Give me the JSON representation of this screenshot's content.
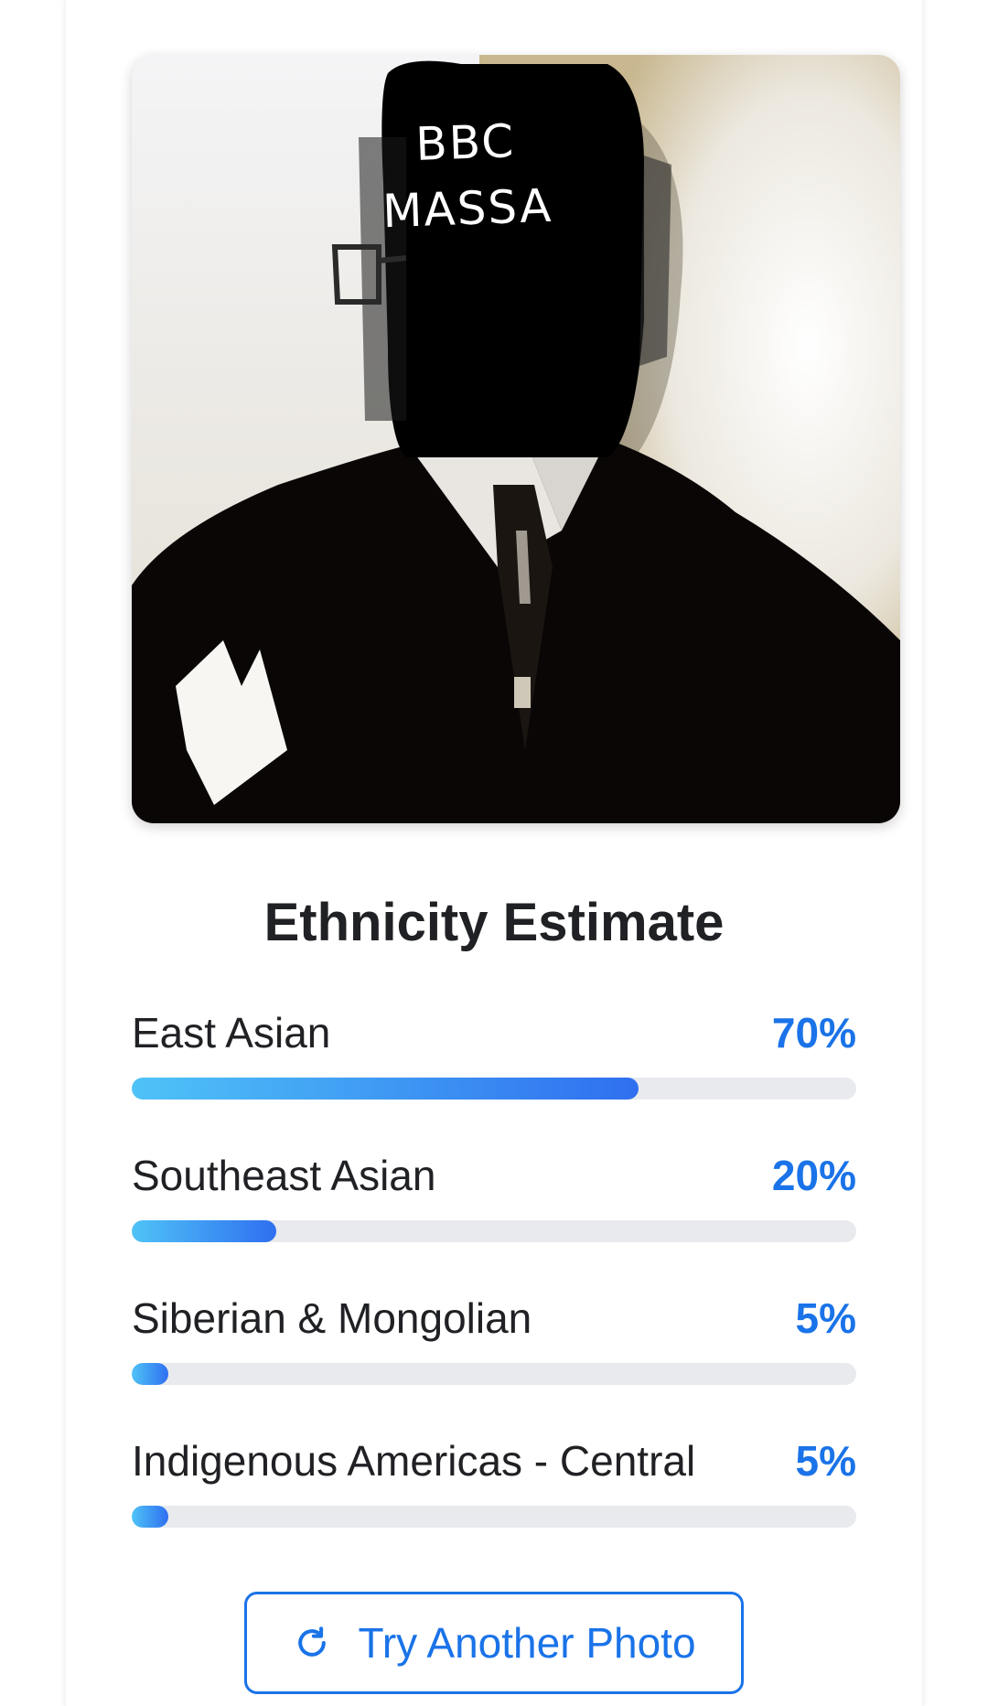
{
  "photo": {
    "caption_line1": "BBC",
    "caption_line2": "MASSA"
  },
  "results": {
    "heading": "Ethnicity Estimate",
    "items": [
      {
        "label": "East Asian",
        "percent_text": "70%",
        "percent": 70
      },
      {
        "label": "Southeast Asian",
        "percent_text": "20%",
        "percent": 20
      },
      {
        "label": "Siberian & Mongolian",
        "percent_text": "5%",
        "percent": 5
      },
      {
        "label": "Indigenous Americas - Central",
        "percent_text": "5%",
        "percent": 5
      }
    ]
  },
  "actions": {
    "try_again_label": "Try Another Photo",
    "try_again_icon": "refresh-icon"
  },
  "colors": {
    "accent": "#1a73e8",
    "bar_start": "#4fc3f7",
    "bar_end": "#2f6ff0",
    "track": "#e8eaed",
    "text": "#202124"
  }
}
